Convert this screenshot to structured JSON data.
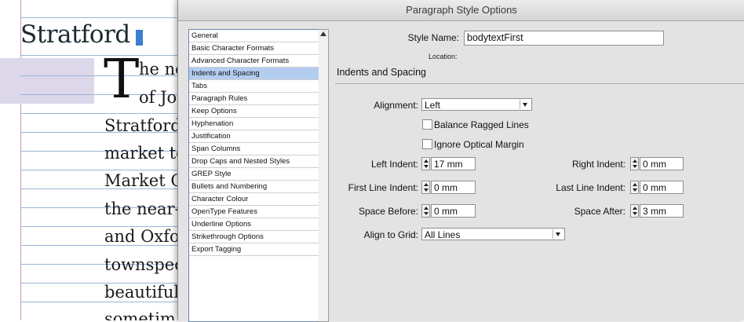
{
  "document": {
    "heading": "Stratford",
    "drop_cap": "T",
    "lines": [
      "he ne",
      "of Jo",
      "Stratford",
      "market to",
      "Market C",
      "the near-",
      "and Oxfo",
      "townspeo",
      "beautiful",
      "sometim"
    ],
    "guide_color": "#9db4d8",
    "shade_color": "#dcd8ea"
  },
  "dialog": {
    "title": "Paragraph Style Options",
    "categories": [
      "General",
      "Basic Character Formats",
      "Advanced Character Formats",
      "Indents and Spacing",
      "Tabs",
      "Paragraph Rules",
      "Keep Options",
      "Hyphenation",
      "Justification",
      "Span Columns",
      "Drop Caps and Nested Styles",
      "GREP Style",
      "Bullets and Numbering",
      "Character Colour",
      "OpenType Features",
      "Underline Options",
      "Strikethrough Options",
      "Export Tagging"
    ],
    "selected_category_index": 3,
    "selection_color": "#b3cdf0",
    "style_name_label": "Style Name:",
    "style_name_value": "bodytextFirst",
    "location_label": "Location:",
    "section_title": "Indents and Spacing",
    "alignment": {
      "label": "Alignment:",
      "value": "Left"
    },
    "balance_ragged": {
      "label": "Balance Ragged Lines",
      "checked": false
    },
    "ignore_optical": {
      "label": "Ignore Optical Margin",
      "checked": false
    },
    "left_indent": {
      "label": "Left Indent:",
      "value": "17 mm"
    },
    "right_indent": {
      "label": "Right Indent:",
      "value": "0 mm"
    },
    "first_line_indent": {
      "label": "First Line Indent:",
      "value": "0 mm"
    },
    "last_line_indent": {
      "label": "Last Line Indent:",
      "value": "0 mm"
    },
    "space_before": {
      "label": "Space Before:",
      "value": "0 mm"
    },
    "space_after": {
      "label": "Space After:",
      "value": "3 mm"
    },
    "align_to_grid": {
      "label": "Align to Grid:",
      "value": "All Lines"
    }
  }
}
